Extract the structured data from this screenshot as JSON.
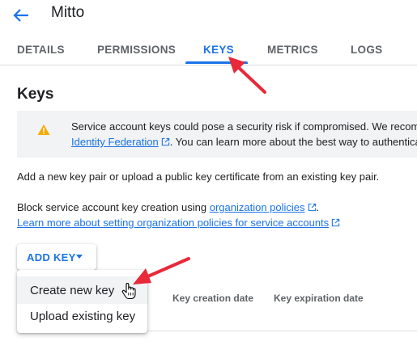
{
  "header": {
    "title": "Mitto",
    "back_icon": "arrow-back-icon"
  },
  "tabs": [
    {
      "label": "DETAILS"
    },
    {
      "label": "PERMISSIONS"
    },
    {
      "label": "KEYS",
      "active": true
    },
    {
      "label": "METRICS"
    },
    {
      "label": "LOGS"
    }
  ],
  "main": {
    "section_title": "Keys",
    "warning": {
      "icon": "warning-icon",
      "line1": "Service account keys could pose a security risk if compromised. We recom",
      "link": "Identity Federation",
      "line2_rest": ". You can learn more about the best way to authentica"
    },
    "intro": "Add a new key pair or upload a public key certificate from an existing key pair.",
    "block_prefix": "Block service account key creation using ",
    "block_link": "organization policies",
    "block_suffix": ".",
    "learn_link": "Learn more about setting organization policies for service accounts",
    "add_key_label": "ADD KEY",
    "table_headers": [
      "Key creation date",
      "Key expiration date"
    ]
  },
  "menu": {
    "items": [
      {
        "label": "Create new key",
        "hovered": true
      },
      {
        "label": "Upload existing key"
      }
    ]
  },
  "colors": {
    "accent": "#1a73e8",
    "warning": "#f9ab00",
    "annotation": "#e8293a"
  }
}
